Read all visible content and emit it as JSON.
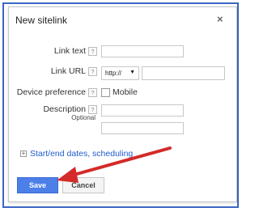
{
  "dialog": {
    "title": "New sitelink",
    "close_glyph": "×"
  },
  "form": {
    "link_text_label": "Link text",
    "link_url_label": "Link URL",
    "protocol_value": "http://",
    "device_label": "Device preference",
    "mobile_label": "Mobile",
    "description_label": "Description",
    "optional_label": "Optional",
    "help_glyph": "?"
  },
  "dates_link": "Start/end dates, scheduling",
  "buttons": {
    "save": "Save",
    "cancel": "Cancel"
  },
  "annotation": {
    "arrow_color": "#d42a2a"
  }
}
